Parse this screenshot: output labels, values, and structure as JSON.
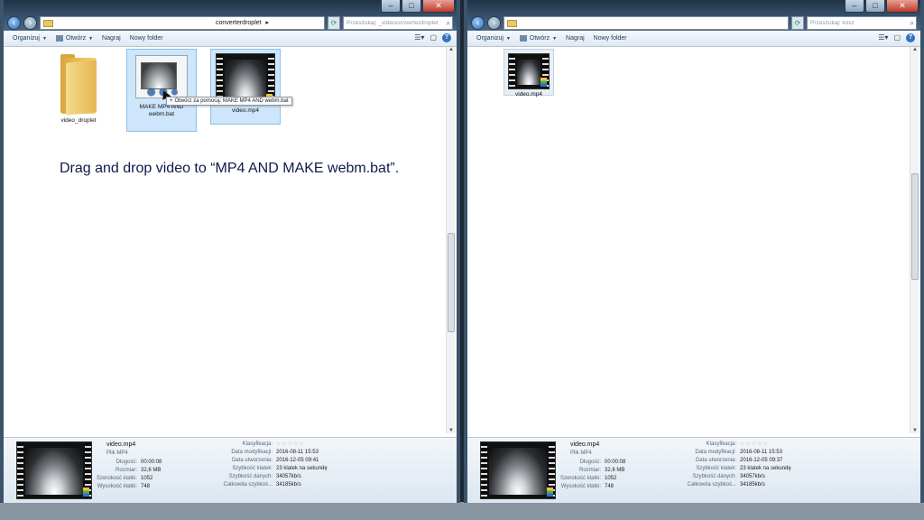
{
  "left_window": {
    "address": "converterdroplet",
    "address_arrow": "▸",
    "search_placeholder": "Przeszukaj: _videoconverterdroplet",
    "toolbar": {
      "organize": "Organizuj",
      "open": "Otwórz",
      "burn": "Nagraj",
      "new_folder": "Nowy folder"
    },
    "items": [
      {
        "label": "video_droplet"
      },
      {
        "label": "MAKE MP4 AND webm.bat"
      },
      {
        "label": "video.mp4"
      }
    ],
    "tooltip": "Otwórz za pomocą: MAKE MP4 AND webm.bat",
    "details": {
      "name": "video.mp4",
      "type": "Plik MP4",
      "left_labels": [
        "Długość:",
        "Rozmiar:",
        "Szerokość klatki:",
        "Wysokość klatki:"
      ],
      "left_values": [
        "00:00:08",
        "32,6 MB",
        "1052",
        "748"
      ],
      "right_labels": [
        "Klasyfikacja:",
        "Data modyfikacji:",
        "Data utworzenia:",
        "Szybkość klatek:",
        "Szybkość danych:",
        "Całkowita szybkoś..."
      ],
      "right_values": [
        "☆☆☆☆☆",
        "2016-08-11 15:53",
        "2016-12-05 09:41",
        "23 klatek na sekundę",
        "34057kb/s",
        "34185kb/s"
      ]
    }
  },
  "right_window": {
    "address": "",
    "search_placeholder": "Przeszukaj: kosz",
    "toolbar": {
      "organize": "Organizuj",
      "open": "Otwórz",
      "burn": "Nagraj",
      "new_folder": "Nowy folder"
    },
    "items": [
      {
        "label": "video.mp4"
      }
    ],
    "details": {
      "name": "video.mp4",
      "type": "Plik MP4",
      "left_labels": [
        "Długość:",
        "Rozmiar:",
        "Szerokość klatki:",
        "Wysokość klatki:"
      ],
      "left_values": [
        "00:00:08",
        "32,6 MB",
        "1052",
        "748"
      ],
      "right_labels": [
        "Klasyfikacja:",
        "Data modyfikacji:",
        "Data utworzenia:",
        "Szybkość klatek:",
        "Szybkość danych:",
        "Całkowita szybkoś..."
      ],
      "right_values": [
        "☆☆☆☆☆",
        "2016-08-11 15:53",
        "2016-12-05 09:37",
        "23 klatek na sekundę",
        "34057kb/s",
        "34185kb/s"
      ]
    }
  },
  "caption": "Drag and drop video to “MP4 AND MAKE webm.bat”.",
  "colors": {
    "selection": "#cde6fb",
    "caption": "#101a4a",
    "window_frame": "#3b536b"
  }
}
